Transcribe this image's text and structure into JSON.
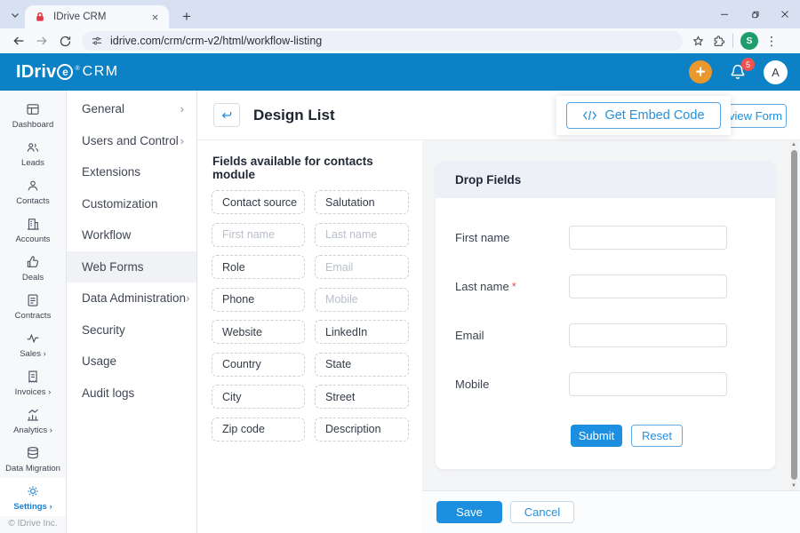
{
  "browser": {
    "tab_title": "IDrive CRM",
    "url": "idrive.com/crm/crm-v2/html/workflow-listing",
    "profile_initial": "S"
  },
  "app_header": {
    "logo_prefix": "IDriv",
    "logo_e": "e",
    "logo_reg": "®",
    "logo_suffix": "CRM",
    "notification_count": "5",
    "avatar_initial": "A"
  },
  "nav_rail": {
    "items": [
      {
        "label": "Dashboard"
      },
      {
        "label": "Leads"
      },
      {
        "label": "Contacts"
      },
      {
        "label": "Accounts"
      },
      {
        "label": "Deals"
      },
      {
        "label": "Contracts"
      },
      {
        "label": "Sales ›"
      },
      {
        "label": "Invoices ›"
      },
      {
        "label": "Analytics ›"
      },
      {
        "label": "Data Migration"
      },
      {
        "label": "Settings ›"
      }
    ],
    "copyright": "© IDrive Inc."
  },
  "settings_menu": {
    "items": [
      {
        "label": "General",
        "chevron": "›"
      },
      {
        "label": "Users and Control",
        "chevron": "›"
      },
      {
        "label": "Extensions",
        "chevron": ""
      },
      {
        "label": "Customization",
        "chevron": ""
      },
      {
        "label": "Workflow",
        "chevron": ""
      },
      {
        "label": "Web Forms",
        "chevron": ""
      },
      {
        "label": "Data Administration",
        "chevron": "›"
      },
      {
        "label": "Security",
        "chevron": ""
      },
      {
        "label": "Usage",
        "chevron": ""
      },
      {
        "label": "Audit logs",
        "chevron": ""
      }
    ]
  },
  "main": {
    "page_title": "Design List",
    "preview_form_label": "view Form",
    "embed_button_label": "Get Embed Code",
    "fields_heading": "Fields available for contacts module",
    "chips": [
      {
        "label": "Contact source",
        "disabled": false
      },
      {
        "label": "Salutation",
        "disabled": false
      },
      {
        "label": "First name",
        "disabled": true
      },
      {
        "label": "Last name",
        "disabled": true
      },
      {
        "label": "Role",
        "disabled": false
      },
      {
        "label": "Email",
        "disabled": true
      },
      {
        "label": "Phone",
        "disabled": false
      },
      {
        "label": "Mobile",
        "disabled": true
      },
      {
        "label": "Website",
        "disabled": false
      },
      {
        "label": "LinkedIn",
        "disabled": false
      },
      {
        "label": "Country",
        "disabled": false
      },
      {
        "label": "State",
        "disabled": false
      },
      {
        "label": "City",
        "disabled": false
      },
      {
        "label": "Street",
        "disabled": false
      },
      {
        "label": "Zip code",
        "disabled": false
      },
      {
        "label": "Description",
        "disabled": false
      }
    ],
    "form_builder": {
      "heading": "Drop Fields",
      "rows": [
        {
          "label": "First name",
          "required_mark": ""
        },
        {
          "label": "Last name",
          "required_mark": "*"
        },
        {
          "label": "Email",
          "required_mark": ""
        },
        {
          "label": "Mobile",
          "required_mark": ""
        }
      ],
      "submit_label": "Submit",
      "reset_label": "Reset"
    },
    "footer": {
      "save_label": "Save",
      "cancel_label": "Cancel"
    }
  },
  "colors": {
    "header_blue": "#0d81c6",
    "accent_blue": "#1d8fe1",
    "add_button_orange": "#e8982c",
    "badge_red": "#ef5350"
  },
  "glyphs": {
    "plus": "+",
    "kebab": "⋮",
    "scroll_up": "▲",
    "scroll_down": "▼"
  }
}
